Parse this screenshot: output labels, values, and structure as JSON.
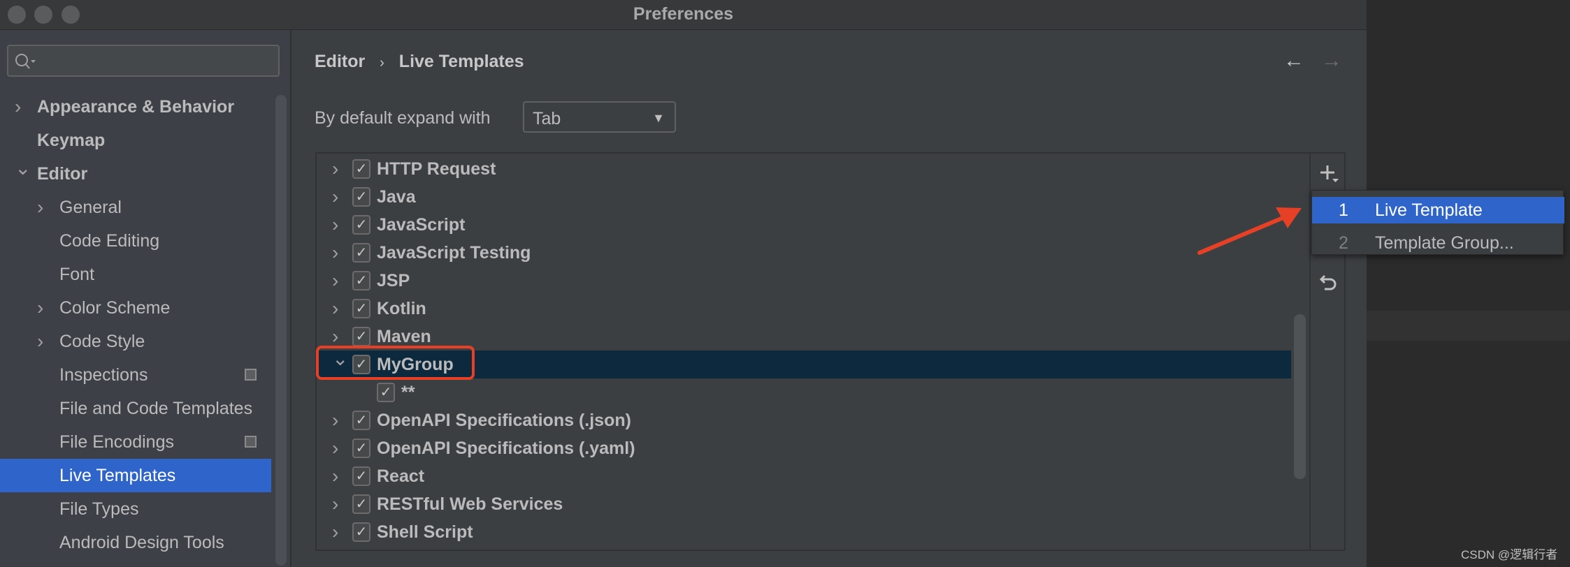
{
  "window": {
    "title": "Preferences"
  },
  "sidebar": {
    "search_placeholder": "",
    "items": [
      {
        "label": "Appearance & Behavior",
        "level": 0,
        "expander": "collapsed",
        "bold": true
      },
      {
        "label": "Keymap",
        "level": 0,
        "expander": "none",
        "bold": true
      },
      {
        "label": "Editor",
        "level": 0,
        "expander": "expanded",
        "bold": true
      },
      {
        "label": "General",
        "level": 1,
        "expander": "collapsed"
      },
      {
        "label": "Code Editing",
        "level": 1,
        "expander": "none"
      },
      {
        "label": "Font",
        "level": 1,
        "expander": "none"
      },
      {
        "label": "Color Scheme",
        "level": 1,
        "expander": "collapsed"
      },
      {
        "label": "Code Style",
        "level": 1,
        "expander": "collapsed"
      },
      {
        "label": "Inspections",
        "level": 1,
        "expander": "none",
        "badge": true
      },
      {
        "label": "File and Code Templates",
        "level": 1,
        "expander": "none"
      },
      {
        "label": "File Encodings",
        "level": 1,
        "expander": "none",
        "badge": true
      },
      {
        "label": "Live Templates",
        "level": 1,
        "expander": "none",
        "selected": true
      },
      {
        "label": "File Types",
        "level": 1,
        "expander": "none"
      },
      {
        "label": "Android Design Tools",
        "level": 1,
        "expander": "none"
      }
    ]
  },
  "breadcrumb": {
    "parent": "Editor",
    "separator": "›",
    "current": "Live Templates"
  },
  "nav": {
    "back": "←",
    "forward": "→"
  },
  "expand": {
    "label": "By default expand with",
    "value": "Tab"
  },
  "tree": {
    "rows": [
      {
        "label": "HTTP Request",
        "checked": true,
        "expander": "collapsed"
      },
      {
        "label": "Java",
        "checked": true,
        "expander": "collapsed"
      },
      {
        "label": "JavaScript",
        "checked": true,
        "expander": "collapsed"
      },
      {
        "label": "JavaScript Testing",
        "checked": true,
        "expander": "collapsed"
      },
      {
        "label": "JSP",
        "checked": true,
        "expander": "collapsed"
      },
      {
        "label": "Kotlin",
        "checked": true,
        "expander": "collapsed"
      },
      {
        "label": "Maven",
        "checked": true,
        "expander": "collapsed"
      },
      {
        "label": "MyGroup",
        "checked": true,
        "expander": "expanded",
        "selected": true,
        "highlighted": true
      },
      {
        "label": "**",
        "checked": true,
        "expander": "none",
        "child": true
      },
      {
        "label": "OpenAPI Specifications (.json)",
        "checked": true,
        "expander": "collapsed"
      },
      {
        "label": "OpenAPI Specifications (.yaml)",
        "checked": true,
        "expander": "collapsed"
      },
      {
        "label": "React",
        "checked": true,
        "expander": "collapsed"
      },
      {
        "label": "RESTful Web Services",
        "checked": true,
        "expander": "collapsed"
      },
      {
        "label": "Shell Script",
        "checked": true,
        "expander": "collapsed"
      }
    ]
  },
  "toolbar": {
    "add_icon": "plus-dropdown-icon",
    "revert_icon": "undo-icon"
  },
  "popup": {
    "items": [
      {
        "number": "1",
        "label": "Live Template",
        "selected": true
      },
      {
        "number": "2",
        "label": "Template Group..."
      }
    ]
  },
  "annotation": {
    "arrow_color": "#e64026",
    "box_color": "#e64026"
  },
  "watermark": "CSDN @逻辑行者",
  "colors": {
    "selection": "#2f65ca",
    "tree_selection": "#0d293e",
    "background": "#3c3f41"
  }
}
